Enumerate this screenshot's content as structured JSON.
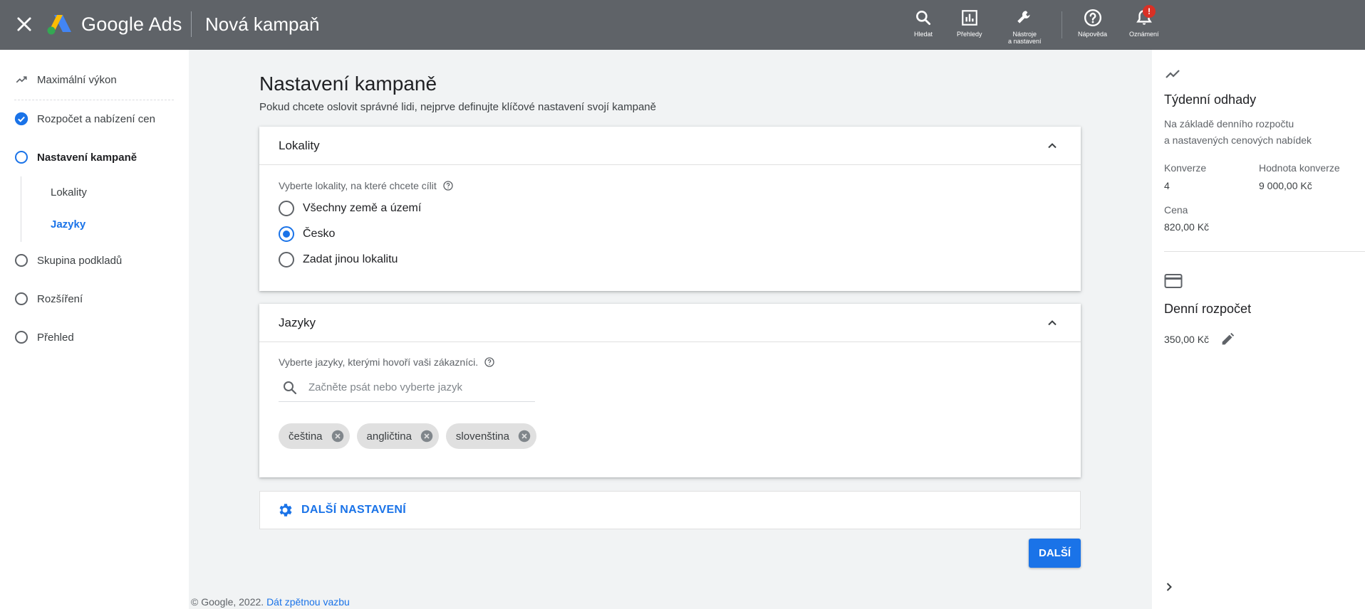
{
  "topbar": {
    "brand": "Google Ads",
    "campaign_title": "Nová kampaň",
    "items": [
      {
        "icon": "search-icon",
        "label": "Hledat"
      },
      {
        "icon": "reports-icon",
        "label": "Přehledy"
      },
      {
        "icon": "wrench-icon",
        "label_line1": "Nástroje",
        "label_line2": "a nastavení"
      },
      {
        "icon": "help-icon",
        "label": "Nápověda"
      },
      {
        "icon": "bell-icon",
        "label": "Oznámení",
        "badge": "!"
      }
    ]
  },
  "sidebar": {
    "items": [
      {
        "label": "Maximální výkon",
        "icon": "trend-icon"
      },
      {
        "label": "Rozpočet a nabízení cen",
        "icon": "check-circle-icon",
        "state": "done"
      },
      {
        "label": "Nastavení kampaně",
        "icon": "circle-icon",
        "state": "active"
      },
      {
        "label": "Skupina podkladů",
        "icon": "circle-icon"
      },
      {
        "label": "Rozšíření",
        "icon": "circle-icon"
      },
      {
        "label": "Přehled",
        "icon": "circle-icon"
      }
    ],
    "subitems": [
      {
        "label": "Lokality"
      },
      {
        "label": "Jazyky",
        "state": "active"
      }
    ]
  },
  "main": {
    "title": "Nastavení kampaně",
    "subtitle": "Pokud chcete oslovit správné lidi, nejprve definujte klíčové nastavení svojí kampaně",
    "locations": {
      "header": "Lokality",
      "label": "Vyberte lokality, na které chcete cílit",
      "options": [
        "Všechny země a území",
        "Česko",
        "Zadat jinou lokalitu"
      ],
      "selected": "Česko"
    },
    "languages": {
      "header": "Jazyky",
      "label": "Vyberte jazyky, kterými hovoří vaši zákazníci.",
      "search_placeholder": "Začněte psát nebo vyberte jazyk",
      "chips": [
        "čeština",
        "angličtina",
        "slovenština"
      ]
    },
    "more_settings": "DALŠÍ NASTAVENÍ",
    "next_button": "DALŠÍ",
    "footer": {
      "copyright": "© Google, 2022.",
      "feedback_link": "Dát zpětnou vazbu"
    }
  },
  "right_panel": {
    "weekly": {
      "title": "Týdenní odhady",
      "desc_line1": "Na základě denního rozpočtu",
      "desc_line2": "a nastavených cenových nabídek",
      "conversions_label": "Konverze",
      "conversions_value": "4",
      "conv_value_label": "Hodnota konverze",
      "conv_value_value": "9 000,00 Kč",
      "cost_label": "Cena",
      "cost_value": "820,00 Kč"
    },
    "budget": {
      "title": "Denní rozpočet",
      "value": "350,00 Kč"
    }
  },
  "colors": {
    "topbar": "#5f6368",
    "accent": "#1a73e8",
    "background": "#f1f3f4"
  }
}
